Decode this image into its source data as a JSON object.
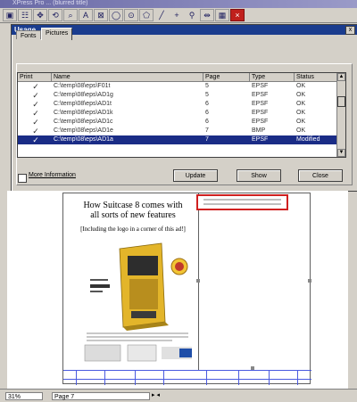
{
  "app": {
    "title": "XPress Pro ...  (blurred title)"
  },
  "toolbar": {
    "items": [
      "item-tool-icon",
      "content-tool-icon",
      "move-icon",
      "rotate-icon",
      "zoom-icon",
      "text-box-icon",
      "picture-box-icon",
      "oval-icon",
      "circle-icon",
      "polygon-icon",
      "line-icon",
      "orthogonal-line-icon",
      "linking-icon",
      "unlinking-icon",
      "table-icon",
      "close-icon"
    ]
  },
  "dialog": {
    "title": "Usage",
    "close_glyph": "x",
    "tabs": [
      "Fonts",
      "Pictures"
    ],
    "columns": {
      "print": "Print",
      "name": "Name",
      "page": "Page",
      "type": "Type",
      "status": "Status"
    },
    "rows": [
      {
        "check": "✓",
        "name": "C:\\temp\\08\\eps\\F01t",
        "page": "5",
        "type": "EPSF",
        "status": "OK"
      },
      {
        "check": "✓",
        "name": "C:\\temp\\08\\eps\\AD1g",
        "page": "5",
        "type": "EPSF",
        "status": "OK"
      },
      {
        "check": "✓",
        "name": "C:\\temp\\08\\eps\\AD1t",
        "page": "6",
        "type": "EPSF",
        "status": "OK"
      },
      {
        "check": "✓",
        "name": "C:\\temp\\08\\eps\\AD1k",
        "page": "6",
        "type": "EPSF",
        "status": "OK"
      },
      {
        "check": "✓",
        "name": "C:\\temp\\08\\eps\\AD1c",
        "page": "6",
        "type": "EPSF",
        "status": "OK"
      },
      {
        "check": "✓",
        "name": "C:\\temp\\08\\eps\\AD1e",
        "page": "7",
        "type": "BMP",
        "status": "OK"
      },
      {
        "check": "✓",
        "name": "C:\\temp\\08\\eps\\AD1a",
        "page": "7",
        "type": "EPSF",
        "status": "Modified"
      }
    ],
    "more_info_label": "More Information",
    "update_label": "Update",
    "show_label": "Show",
    "close_label": "Close"
  },
  "document": {
    "headline": "How Suitcase 8 comes with all sorts of new features",
    "subline": "[Including the logo in a corner of this ad!]"
  },
  "status": {
    "zoom": "31%",
    "page": "Page 7"
  }
}
